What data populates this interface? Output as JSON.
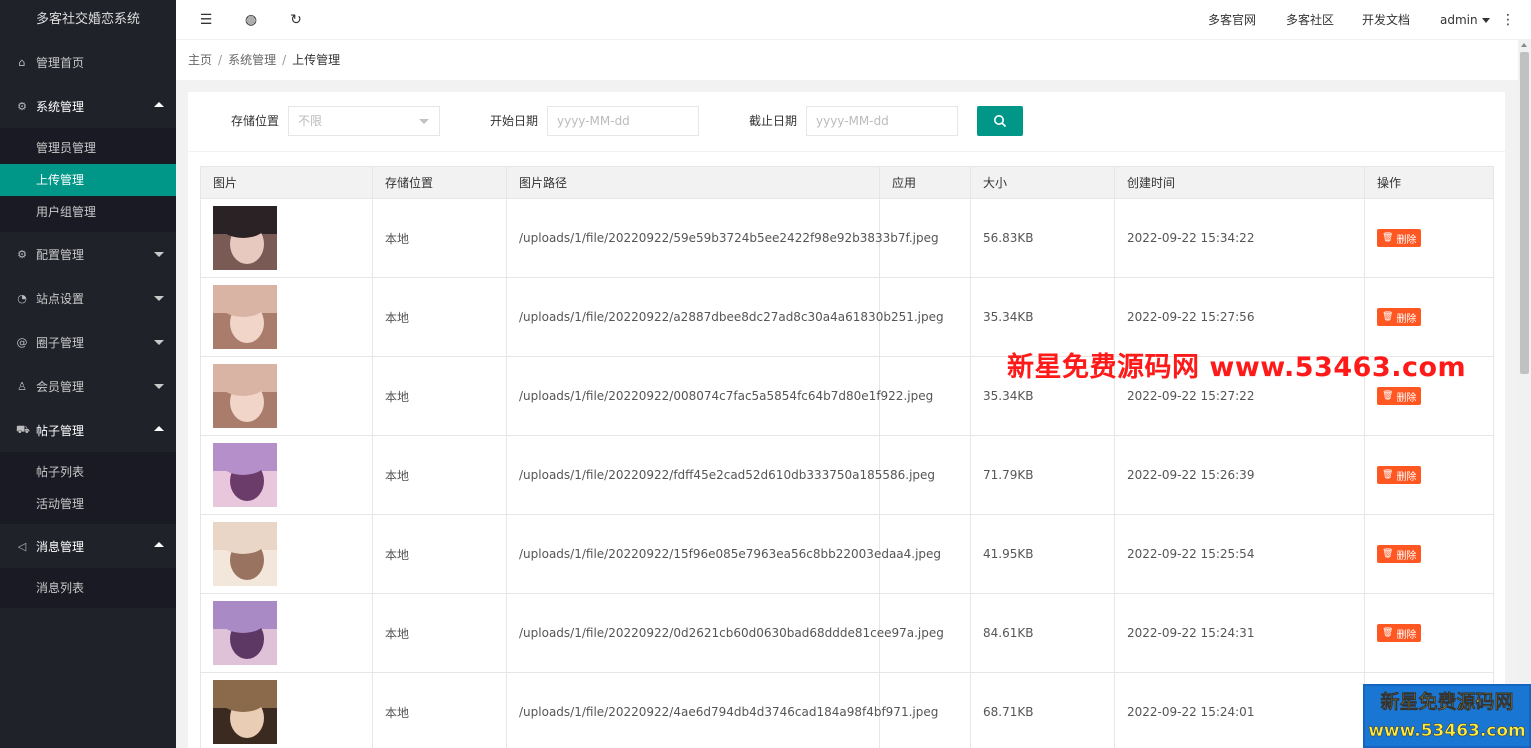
{
  "app_title": "多客社交婚恋系统",
  "sidebar": {
    "home": {
      "label": "管理首页",
      "icon": "home-icon"
    },
    "system": {
      "label": "系统管理",
      "icon": "gear-icon",
      "children": [
        "管理员管理",
        "上传管理",
        "用户组管理"
      ]
    },
    "config": {
      "label": "配置管理",
      "icon": "gear-icon"
    },
    "site": {
      "label": "站点设置",
      "icon": "dashboard-icon"
    },
    "circle": {
      "label": "圈子管理",
      "icon": "at-icon"
    },
    "member": {
      "label": "会员管理",
      "icon": "user-icon"
    },
    "post": {
      "label": "帖子管理",
      "icon": "cart-icon",
      "children": [
        "帖子列表",
        "活动管理"
      ]
    },
    "message": {
      "label": "消息管理",
      "icon": "speaker-icon",
      "children": [
        "消息列表"
      ]
    }
  },
  "header": {
    "links": [
      "多客官网",
      "多客社区",
      "开发文档"
    ],
    "user": "admin"
  },
  "breadcrumb": [
    "主页",
    "系统管理",
    "上传管理"
  ],
  "filters": {
    "storage_label": "存储位置",
    "storage_value": "不限",
    "start_label": "开始日期",
    "start_placeholder": "yyyy-MM-dd",
    "end_label": "截止日期",
    "end_placeholder": "yyyy-MM-dd"
  },
  "table": {
    "columns": [
      "图片",
      "存储位置",
      "图片路径",
      "应用",
      "大小",
      "创建时间",
      "操作"
    ],
    "delete_label": "删除",
    "rows": [
      {
        "storage": "本地",
        "path": "/uploads/1/file/20220922/59e59b3724b5ee2422f98e92b3833b7f.jpeg",
        "app": "",
        "size": "56.83KB",
        "time": "2022-09-22 15:34:22",
        "colors": [
          "#2a2225",
          "#e8c9c0",
          "#7a5a55"
        ]
      },
      {
        "storage": "本地",
        "path": "/uploads/1/file/20220922/a2887dbee8dc27ad8c30a4a61830b251.jpeg",
        "app": "",
        "size": "35.34KB",
        "time": "2022-09-22 15:27:56",
        "colors": [
          "#d9b4a4",
          "#f0d5c8",
          "#a97c6c"
        ]
      },
      {
        "storage": "本地",
        "path": "/uploads/1/file/20220922/008074c7fac5a5854fc64b7d80e1f922.jpeg",
        "app": "",
        "size": "35.34KB",
        "time": "2022-09-22 15:27:22",
        "colors": [
          "#d9b4a4",
          "#f0d5c8",
          "#a97c6c"
        ]
      },
      {
        "storage": "本地",
        "path": "/uploads/1/file/20220922/fdff45e2cad52d610db333750a185586.jpeg",
        "app": "",
        "size": "71.79KB",
        "time": "2022-09-22 15:26:39",
        "colors": [
          "#b48fc9",
          "#6b3b6a",
          "#e8c7dc"
        ]
      },
      {
        "storage": "本地",
        "path": "/uploads/1/file/20220922/15f96e085e7963ea56c8bb22003edaa4.jpeg",
        "app": "",
        "size": "41.95KB",
        "time": "2022-09-22 15:25:54",
        "colors": [
          "#e9d6c6",
          "#9a7360",
          "#f3e6da"
        ]
      },
      {
        "storage": "本地",
        "path": "/uploads/1/file/20220922/0d2621cb60d0630bad68ddde81cee97a.jpeg",
        "app": "",
        "size": "84.61KB",
        "time": "2022-09-22 15:24:31",
        "colors": [
          "#a98ac4",
          "#5e3864",
          "#e0c2d8"
        ]
      },
      {
        "storage": "本地",
        "path": "/uploads/1/file/20220922/4ae6d794db4d3746cad184a98f4bf971.jpeg",
        "app": "",
        "size": "68.71KB",
        "time": "2022-09-22 15:24:01",
        "colors": [
          "#8a6a4a",
          "#e9cdb5",
          "#3a2a20"
        ]
      }
    ]
  },
  "watermark": {
    "text": "新星免费源码网  www.53463.com",
    "badge_line1": "新星免费源码网",
    "badge_line2": "www.53463.com"
  }
}
